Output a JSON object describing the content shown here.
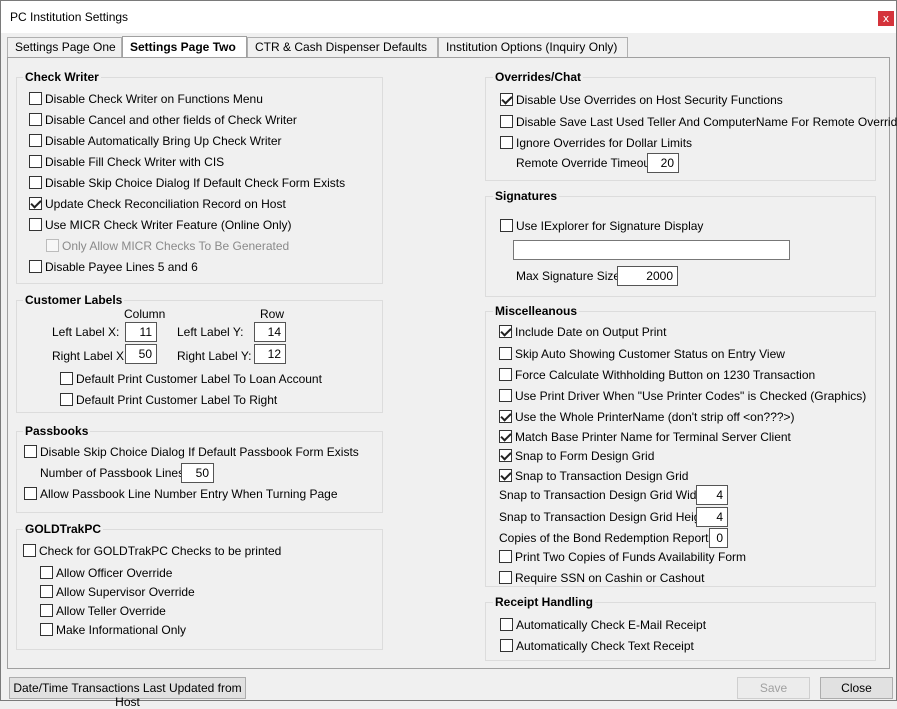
{
  "window": {
    "title": "PC Institution Settings",
    "close_glyph": "x"
  },
  "tabs": [
    "Settings Page One",
    "Settings Page Two",
    "CTR & Cash Dispenser Defaults",
    "Institution Options (Inquiry Only)"
  ],
  "check_writer": {
    "title": "Check Writer",
    "items": [
      {
        "label": "Disable Check Writer on Functions Menu",
        "checked": false
      },
      {
        "label": "Disable Cancel and other fields of Check Writer",
        "checked": false
      },
      {
        "label": "Disable Automatically Bring Up Check Writer",
        "checked": false
      },
      {
        "label": "Disable Fill Check Writer with CIS",
        "checked": false
      },
      {
        "label": "Disable Skip Choice Dialog If Default Check Form Exists",
        "checked": false
      },
      {
        "label": "Update Check Reconciliation Record on Host",
        "checked": true
      },
      {
        "label": "Use MICR Check Writer Feature (Online Only)",
        "checked": false
      },
      {
        "label": "Only Allow MICR Checks To Be Generated",
        "checked": false,
        "disabled": true
      },
      {
        "label": "Disable Payee Lines 5 and 6",
        "checked": false
      }
    ]
  },
  "customer_labels": {
    "title": "Customer Labels",
    "column_header": "Column",
    "row_header": "Row",
    "left_x_label": "Left Label X:",
    "left_x_value": "11",
    "right_x_label": "Right Label X:",
    "right_x_value": "50",
    "left_y_label": "Left Label Y:",
    "left_y_value": "14",
    "right_y_label": "Right Label Y:",
    "right_y_value": "12",
    "items": [
      {
        "label": "Default Print Customer Label To Loan Account",
        "checked": false
      },
      {
        "label": "Default Print Customer Label To Right",
        "checked": false
      }
    ]
  },
  "passbooks": {
    "title": "Passbooks",
    "skip_choice": {
      "label": "Disable Skip Choice Dialog If Default Passbook Form Exists",
      "checked": false
    },
    "lines_label": "Number of Passbook Lines",
    "lines_value": "50",
    "allow_line": {
      "label": "Allow Passbook Line Number Entry When Turning Page",
      "checked": false
    }
  },
  "goldtrak": {
    "title": "GOLDTrakPC",
    "main": {
      "label": "Check for GOLDTrakPC Checks to be printed",
      "checked": false
    },
    "items": [
      {
        "label": "Allow Officer Override",
        "checked": false
      },
      {
        "label": "Allow Supervisor Override",
        "checked": false
      },
      {
        "label": "Allow Teller Override",
        "checked": false
      },
      {
        "label": "Make Informational Only",
        "checked": false
      }
    ]
  },
  "overrides": {
    "title": "Overrides/Chat",
    "items": [
      {
        "label": "Disable Use Overrides on Host Security Functions",
        "checked": true
      },
      {
        "label": "Disable Save Last Used Teller And ComputerName For Remote Override",
        "checked": false
      },
      {
        "label": "Ignore Overrides for Dollar Limits",
        "checked": false
      }
    ],
    "timeout_label": "Remote Override Timeout",
    "timeout_value": "20"
  },
  "signatures": {
    "title": "Signatures",
    "use_iexplorer": {
      "label": "Use IExplorer for Signature Display",
      "checked": false
    },
    "path_value": "",
    "max_label": "Max Signature Size",
    "max_value": "2000"
  },
  "misc": {
    "title": "Miscelleanous",
    "items": [
      {
        "label": "Include Date on Output Print",
        "checked": true
      },
      {
        "label": "Skip Auto Showing Customer Status on Entry View",
        "checked": false
      },
      {
        "label": "Force Calculate Withholding Button on 1230 Transaction",
        "checked": false
      },
      {
        "label": "Use Print Driver When \"Use Printer Codes\" is Checked (Graphics)",
        "checked": false
      },
      {
        "label": "Use the Whole PrinterName (don't strip off <on???>)",
        "checked": true
      },
      {
        "label": "Match Base Printer Name for Terminal Server Client",
        "checked": true
      },
      {
        "label": "Snap to Form Design Grid",
        "checked": true
      },
      {
        "label": "Snap to Transaction Design Grid",
        "checked": true
      }
    ],
    "grid_width_label": "Snap to Transaction Design Grid Width",
    "grid_width_value": "4",
    "grid_height_label": "Snap to Transaction Design Grid Height",
    "grid_height_value": "4",
    "bond_label": "Copies of the Bond Redemption Report",
    "bond_value": "0",
    "items2": [
      {
        "label": "Print Two Copies of Funds Availability Form",
        "checked": false
      },
      {
        "label": "Require SSN on Cashin or Cashout",
        "checked": false
      }
    ]
  },
  "receipt": {
    "title": "Receipt Handling",
    "items": [
      {
        "label": "Automatically Check E-Mail Receipt",
        "checked": false
      },
      {
        "label": "Automatically Check Text Receipt",
        "checked": false
      }
    ]
  },
  "footer": {
    "datetime_button": "Date/Time Transactions Last Updated from Host",
    "save_button": "Save",
    "close_button": "Close"
  }
}
